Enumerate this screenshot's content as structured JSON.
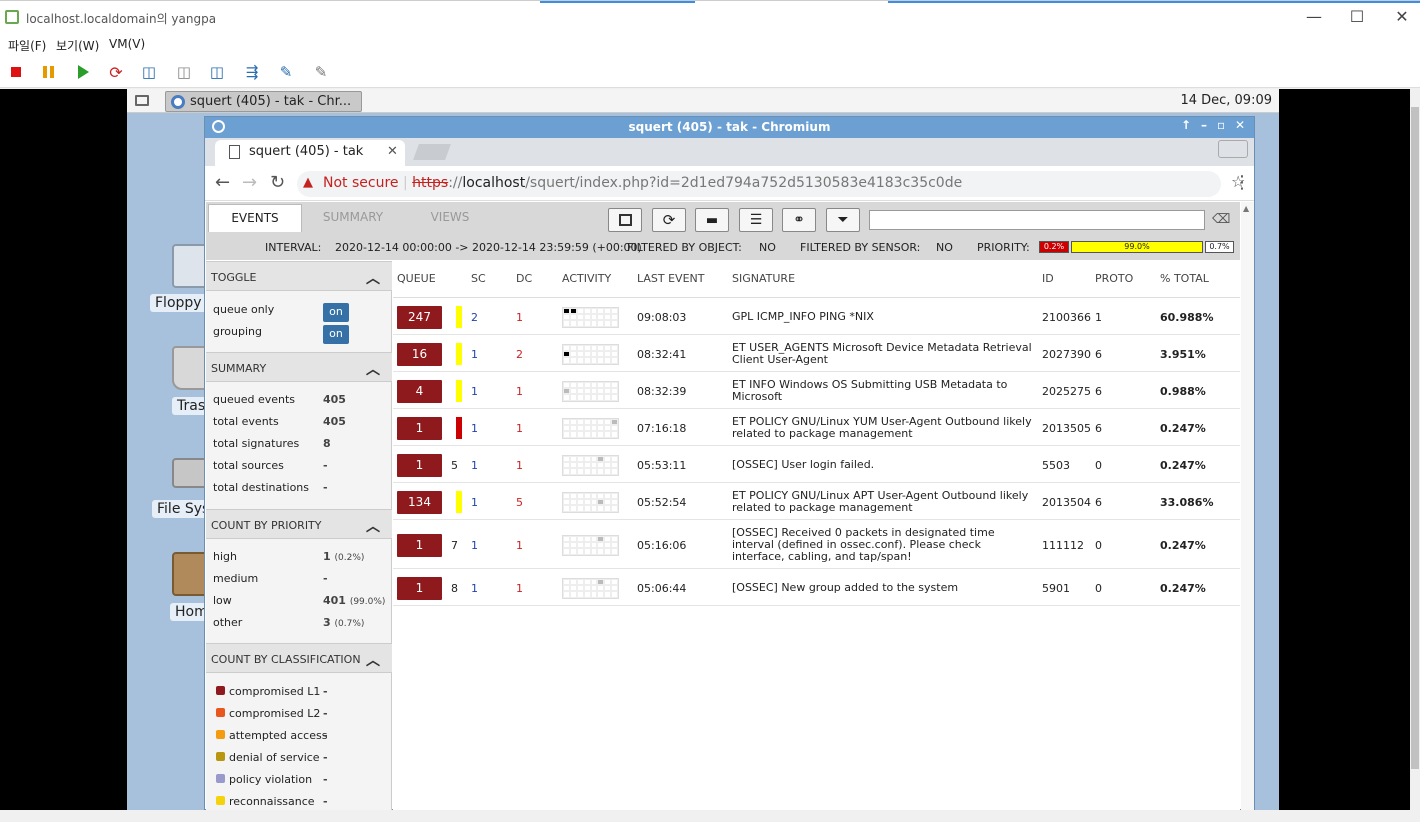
{
  "host": {
    "title": "localhost.localdomain의 yangpa",
    "menu": [
      "파일(F)",
      "보기(W)",
      "VM(V)"
    ]
  },
  "guest": {
    "task_title": "squert (405) - tak - Chr...",
    "clock": "14 Dec, 09:09",
    "desktop_icons": [
      "Floppy",
      "Tras",
      "File Sys",
      "Hom"
    ]
  },
  "browser": {
    "window_title": "squert (405) - tak - Chromium",
    "tab_title": "squert (405) - tak",
    "not_secure": "Not secure",
    "url_scheme": "https",
    "url_sep": "://",
    "url_host": "localhost",
    "url_path": "/squert/index.php?id=2d1ed794a752d5130583e4183c35c0de"
  },
  "squert": {
    "tabs": [
      "EVENTS",
      "SUMMARY",
      "VIEWS"
    ],
    "interval_label": "INTERVAL:",
    "interval_value": "2020-12-14 00:00:00 -> 2020-12-14 23:59:59 (+00:00)",
    "filtered_object_label": "FILTERED BY OBJECT:",
    "filtered_object_value": "NO",
    "filtered_sensor_label": "FILTERED BY SENSOR:",
    "filtered_sensor_value": "NO",
    "priority_label": "PRIORITY:",
    "priority_high": "0.2%",
    "priority_low": "99.0%",
    "priority_other": "0.7%",
    "toggle": {
      "head": "TOGGLE",
      "queue_only": "queue only",
      "grouping": "grouping",
      "on": "on"
    },
    "summary": {
      "head": "SUMMARY",
      "items": [
        {
          "label": "queued events",
          "value": "405"
        },
        {
          "label": "total events",
          "value": "405"
        },
        {
          "label": "total signatures",
          "value": "8"
        },
        {
          "label": "total sources",
          "value": "-"
        },
        {
          "label": "total destinations",
          "value": "-"
        }
      ]
    },
    "priority_counts": {
      "head": "COUNT BY PRIORITY",
      "items": [
        {
          "label": "high",
          "value": "1",
          "pct": "(0.2%)"
        },
        {
          "label": "medium",
          "value": "-",
          "pct": ""
        },
        {
          "label": "low",
          "value": "401",
          "pct": "(99.0%)"
        },
        {
          "label": "other",
          "value": "3",
          "pct": "(0.7%)"
        }
      ]
    },
    "classification": {
      "head": "COUNT BY CLASSIFICATION",
      "items": [
        {
          "label": "compromised L1",
          "value": "-",
          "color": "#8e1a1e"
        },
        {
          "label": "compromised L2",
          "value": "-",
          "color": "#e8581c"
        },
        {
          "label": "attempted access",
          "value": "-",
          "color": "#f39c12"
        },
        {
          "label": "denial of service",
          "value": "-",
          "color": "#b8960f"
        },
        {
          "label": "policy violation",
          "value": "-",
          "color": "#9999cc"
        },
        {
          "label": "reconnaissance",
          "value": "-",
          "color": "#f4d20c"
        }
      ]
    },
    "columns": [
      "QUEUE",
      "SC",
      "DC",
      "ACTIVITY",
      "LAST EVENT",
      "SIGNATURE",
      "ID",
      "PROTO",
      "% TOTAL"
    ],
    "rows": [
      {
        "queue": "247",
        "num": "",
        "sc": "2",
        "dc": "1",
        "last": "09:08:03",
        "sig": "GPL ICMP_INFO PING *NIX",
        "id": "2100366",
        "proto": "1",
        "pct": "60.988%",
        "prio": "#ffff00"
      },
      {
        "queue": "16",
        "num": "",
        "sc": "1",
        "dc": "2",
        "last": "08:32:41",
        "sig": "ET USER_AGENTS Microsoft Device Metadata Retrieval Client User-Agent",
        "id": "2027390",
        "proto": "6",
        "pct": "3.951%",
        "prio": "#ffff00"
      },
      {
        "queue": "4",
        "num": "",
        "sc": "1",
        "dc": "1",
        "last": "08:32:39",
        "sig": "ET INFO Windows OS Submitting USB Metadata to Microsoft",
        "id": "2025275",
        "proto": "6",
        "pct": "0.988%",
        "prio": "#ffff00"
      },
      {
        "queue": "1",
        "num": "",
        "sc": "1",
        "dc": "1",
        "last": "07:16:18",
        "sig": "ET POLICY GNU/Linux YUM User-Agent Outbound likely related to package management",
        "id": "2013505",
        "proto": "6",
        "pct": "0.247%",
        "prio": "#cc0000"
      },
      {
        "queue": "1",
        "num": "5",
        "sc": "1",
        "dc": "1",
        "last": "05:53:11",
        "sig": "[OSSEC] User login failed.",
        "id": "5503",
        "proto": "0",
        "pct": "0.247%",
        "prio": ""
      },
      {
        "queue": "134",
        "num": "",
        "sc": "1",
        "dc": "5",
        "last": "05:52:54",
        "sig": "ET POLICY GNU/Linux APT User-Agent Outbound likely related to package management",
        "id": "2013504",
        "proto": "6",
        "pct": "33.086%",
        "prio": "#ffff00"
      },
      {
        "queue": "1",
        "num": "7",
        "sc": "1",
        "dc": "1",
        "last": "05:16:06",
        "sig": "[OSSEC] Received 0 packets in designated time interval (defined in ossec.conf). Please check interface, cabling, and tap/span!",
        "id": "111112",
        "proto": "0",
        "pct": "0.247%",
        "prio": ""
      },
      {
        "queue": "1",
        "num": "8",
        "sc": "1",
        "dc": "1",
        "last": "05:06:44",
        "sig": "[OSSEC] New group added to the system",
        "id": "5901",
        "proto": "0",
        "pct": "0.247%",
        "prio": ""
      }
    ]
  }
}
